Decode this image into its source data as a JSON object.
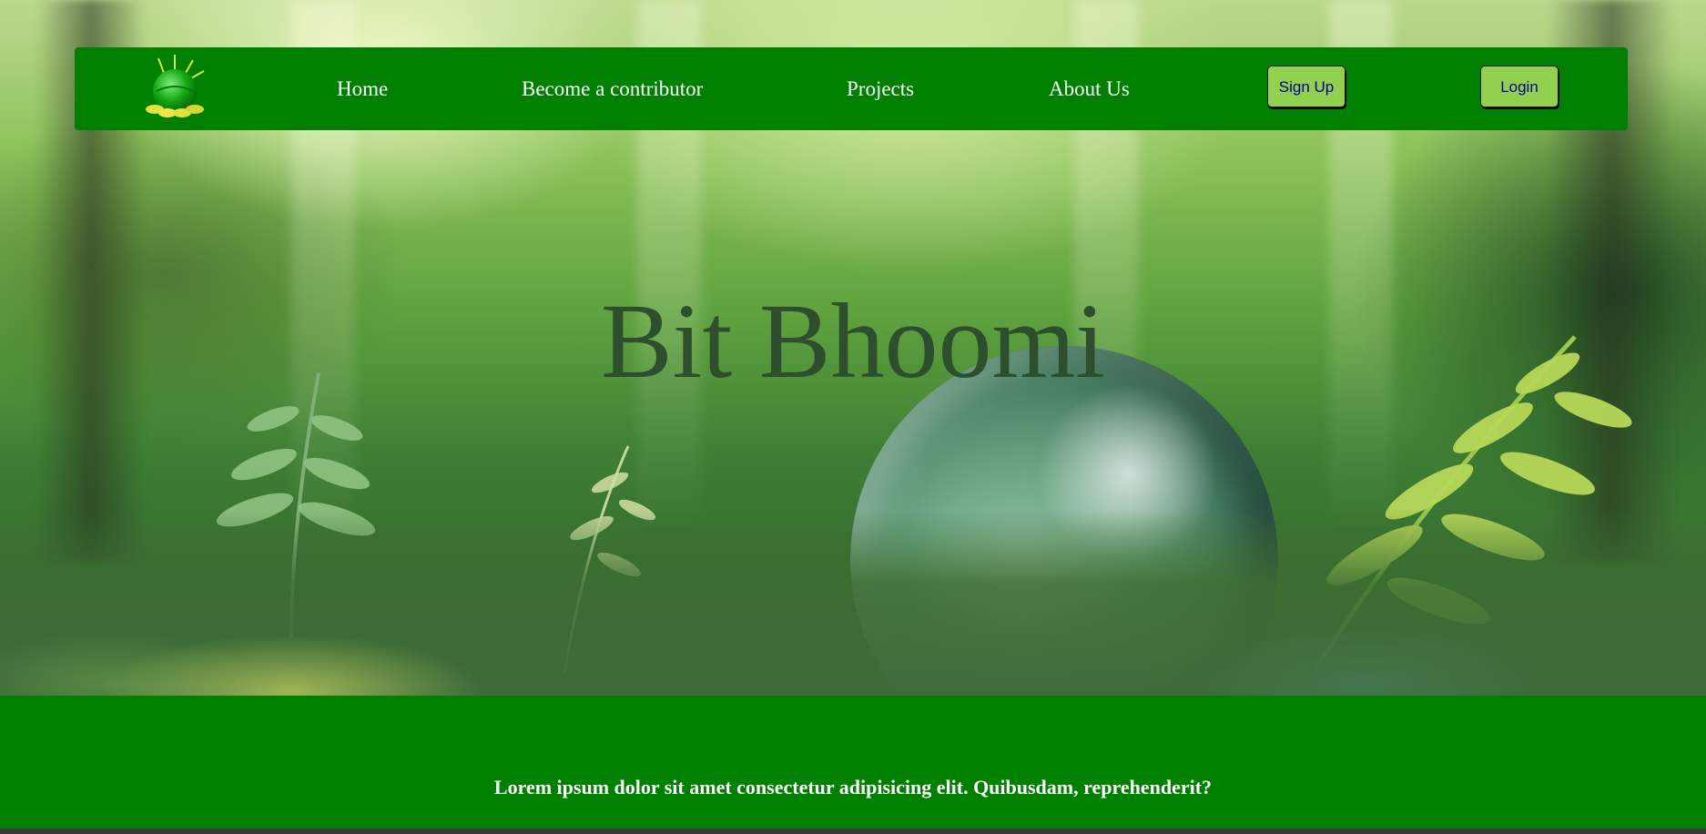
{
  "navbar": {
    "logo_name": "globe-logo",
    "links": [
      {
        "label": "Home"
      },
      {
        "label": "Become a contributor"
      },
      {
        "label": "Projects"
      },
      {
        "label": "About Us"
      }
    ],
    "signup_label": "Sign Up",
    "login_label": "Login"
  },
  "hero": {
    "title": "Bit Bhoomi"
  },
  "band": {
    "text": "Lorem ipsum dolor sit amet consectetur adipisicing elit. Quibusdam, reprehenderit?"
  },
  "colors": {
    "nav_bg": "#008000",
    "button_bg": "#92d050",
    "button_text": "#00008b",
    "title_color": "#2e4f2e",
    "band_bg": "#008000"
  }
}
